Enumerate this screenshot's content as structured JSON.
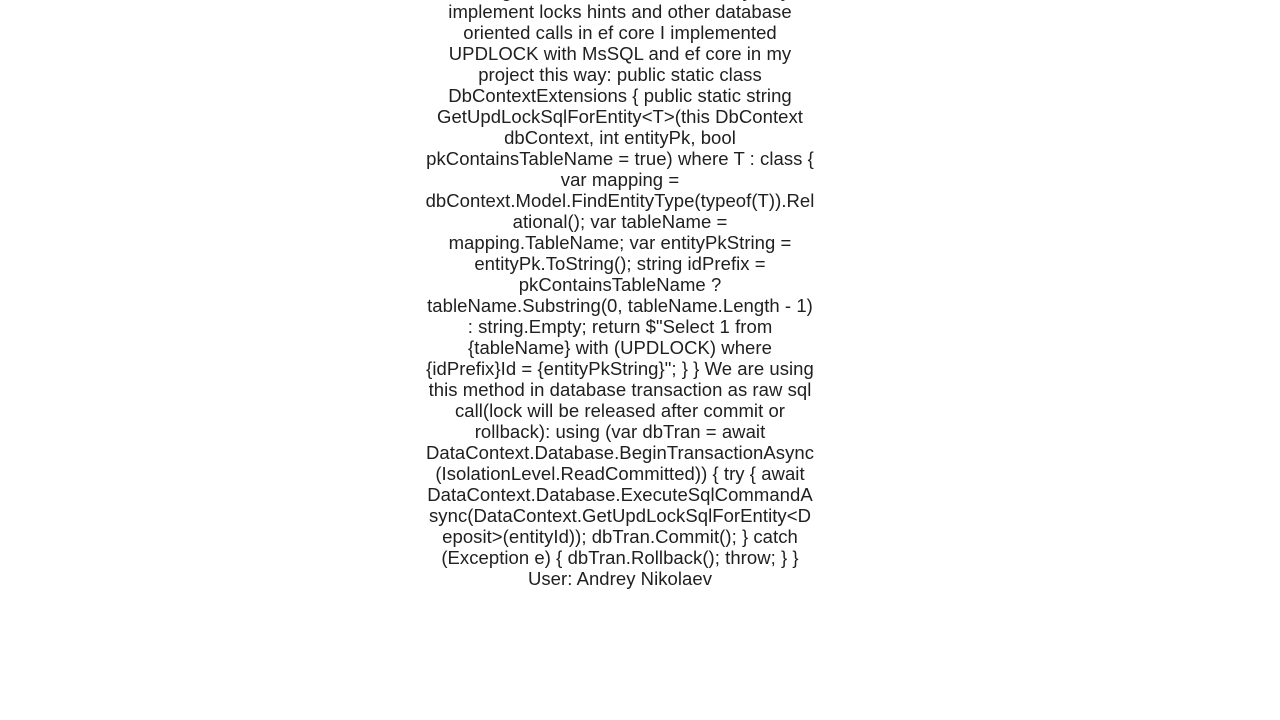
{
  "body": "According to this issue there is no easy way to implement locks hints and other database oriented calls in ef core I implemented UPDLOCK with MsSQL and ef core in my project this way: public static class DbContextExtensions {     public static string GetUpdLockSqlForEntity<T>(this DbContext dbContext, int entityPk, bool pkContainsTableName = true) where T : class     {         var mapping = dbContext.Model.FindEntityType(typeof(T)).Relational();         var tableName = mapping.TableName;         var entityPkString = entityPk.ToString();         string idPrefix = pkContainsTableName ? tableName.Substring(0, tableName.Length - 1) : string.Empty;         return $\"Select 1 from {tableName} with (UPDLOCK) where {idPrefix}Id = {entityPkString}\";     } }  We are using this method in database transaction as raw sql call(lock will be released after commit or rollback): using (var dbTran = await DataContext.Database.BeginTransactionAsync(IsolationLevel.ReadCommitted))     {     try     {         await DataContext.Database.ExecuteSqlCommandAsync(DataContext.GetUpdLockSqlForEntity<Deposit>(entityId));         dbTran.Commit();     }     catch (Exception e)     {         dbTran.Rollback();         throw;     }     }   User: Andrey Nikolaev"
}
